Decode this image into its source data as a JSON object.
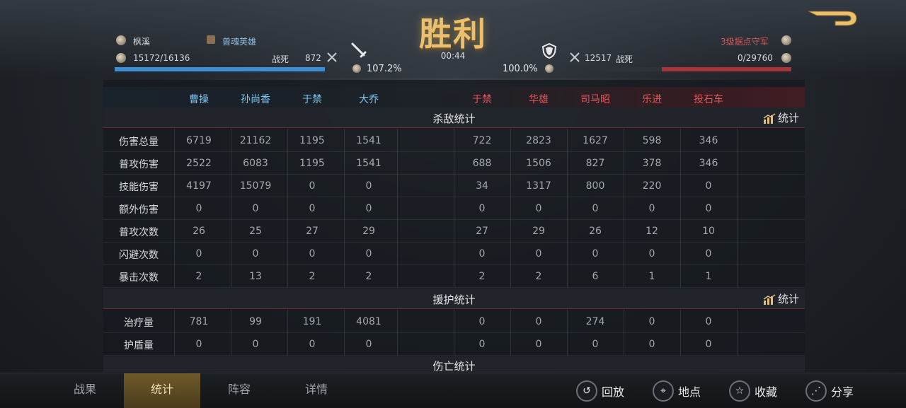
{
  "header": {
    "title": "胜利",
    "time": "00:44",
    "left": {
      "player_name": "枫溪",
      "guild": "兽魂英雄",
      "troops": "15172/16136",
      "kill_label": "战死",
      "kills": "872",
      "morale_pct": "107.2%",
      "bar_fill": 0.94
    },
    "right": {
      "player_name": "3级据点守军",
      "kills": "12517",
      "kill_label": "战死",
      "troops": "0/29760",
      "morale_pct": "100.0%",
      "bar_fill": 0.58
    }
  },
  "heroes": {
    "left": [
      "曹操",
      "孙尚香",
      "于禁",
      "大乔"
    ],
    "right": [
      "于禁",
      "华雄",
      "司马昭",
      "乐进",
      "投石车"
    ]
  },
  "sections": {
    "kill": {
      "title": "杀敌统计",
      "stat_label": "统计"
    },
    "support": {
      "title": "援护统计",
      "stat_label": "统计"
    },
    "loss": {
      "title": "伤亡统计"
    }
  },
  "kill_rows": [
    {
      "label": "伤害总量",
      "values": [
        "6719",
        "21162",
        "1195",
        "1541",
        "722",
        "2823",
        "1627",
        "598",
        "346"
      ]
    },
    {
      "label": "普攻伤害",
      "values": [
        "2522",
        "6083",
        "1195",
        "1541",
        "688",
        "1506",
        "827",
        "378",
        "346"
      ]
    },
    {
      "label": "技能伤害",
      "values": [
        "4197",
        "15079",
        "0",
        "0",
        "34",
        "1317",
        "800",
        "220",
        "0"
      ]
    },
    {
      "label": "额外伤害",
      "values": [
        "0",
        "0",
        "0",
        "0",
        "0",
        "0",
        "0",
        "0",
        "0"
      ]
    },
    {
      "label": "普攻次数",
      "values": [
        "26",
        "25",
        "27",
        "29",
        "27",
        "29",
        "26",
        "12",
        "10"
      ]
    },
    {
      "label": "闪避次数",
      "values": [
        "0",
        "0",
        "0",
        "0",
        "0",
        "0",
        "0",
        "0",
        "0"
      ]
    },
    {
      "label": "暴击次数",
      "values": [
        "2",
        "13",
        "2",
        "2",
        "2",
        "2",
        "6",
        "1",
        "1"
      ]
    }
  ],
  "support_rows": [
    {
      "label": "治疗量",
      "values": [
        "781",
        "99",
        "191",
        "4081",
        "0",
        "0",
        "274",
        "0",
        "0"
      ]
    },
    {
      "label": "护盾量",
      "values": [
        "0",
        "0",
        "0",
        "0",
        "0",
        "0",
        "0",
        "0",
        "0"
      ]
    }
  ],
  "footer": {
    "tabs": [
      "战果",
      "统计",
      "阵容",
      "详情"
    ],
    "active_tab": 1,
    "actions": [
      {
        "label": "回放",
        "icon": "replay-icon"
      },
      {
        "label": "地点",
        "icon": "location-icon"
      },
      {
        "label": "收藏",
        "icon": "star-icon"
      },
      {
        "label": "分享",
        "icon": "share-icon"
      }
    ]
  }
}
